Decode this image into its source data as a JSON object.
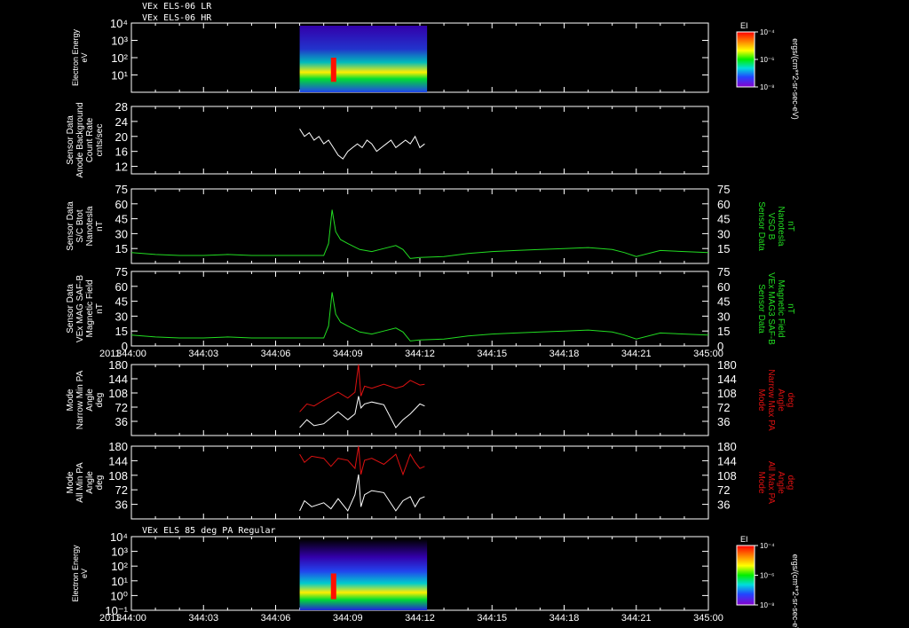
{
  "header": {
    "line1": "VEx ELS-06 LR",
    "line2": "VEx ELS-06 HR",
    "bottom_title": "VEx ELS 85 deg PA Regular"
  },
  "colors": {
    "white": "#ffffff",
    "green": "#22dd22",
    "red": "#dd1111",
    "background": "#000000"
  },
  "colorbar": {
    "label": "EI",
    "units": "ergs/(cm**2-sr-sec-eV)",
    "tick_labels": [
      "10⁻⁴",
      "10⁻⁶",
      "10⁻⁸"
    ]
  },
  "time_axis": {
    "year": "2011",
    "tick_labels": [
      "344:00",
      "344:03",
      "344:06",
      "344:09",
      "344:12",
      "344:15",
      "344:18",
      "344:21",
      "345:00"
    ],
    "range_min": [
      0,
      24
    ]
  },
  "chart_data": [
    {
      "type": "heatmap",
      "name": "panel1",
      "ylabel_lines": [
        "Electron Energy",
        "eV"
      ],
      "y_scale": "log",
      "yticks": [
        "10⁴",
        "10³",
        "10²",
        "10¹"
      ],
      "ylim": [
        1,
        10000
      ],
      "data_span_min": [
        7,
        12.3
      ],
      "grid": false
    },
    {
      "type": "line",
      "name": "panel2",
      "ylabel_lines": [
        "Sensor Data",
        "Anode Background",
        "Count Rate",
        "cnts/sec"
      ],
      "yticks": [
        "28",
        "24",
        "20",
        "16",
        "12"
      ],
      "ylim": [
        10,
        28
      ],
      "series": [
        {
          "color": "white",
          "x": [
            7,
            7.2,
            7.4,
            7.6,
            7.8,
            8.0,
            8.2,
            8.4,
            8.6,
            8.8,
            9.0,
            9.2,
            9.4,
            9.6,
            9.8,
            10.0,
            10.2,
            10.4,
            10.6,
            10.8,
            11.0,
            11.2,
            11.4,
            11.6,
            11.8,
            12.0,
            12.2
          ],
          "y": [
            22,
            20,
            21,
            19,
            20,
            18,
            19,
            17,
            15,
            14,
            16,
            17,
            18,
            17,
            19,
            18,
            16,
            17,
            18,
            19,
            17,
            18,
            19,
            18,
            20,
            17,
            18
          ]
        }
      ]
    },
    {
      "type": "line",
      "name": "panel3",
      "ylabel_lines": [
        "Sensor Data",
        "S/C Btot",
        "Nanotesla",
        "nT"
      ],
      "ylabel_right_lines": [
        "Sensor Data",
        "VSO B",
        "Nanotesla",
        "nT"
      ],
      "yticks": [
        "75",
        "60",
        "45",
        "30",
        "15"
      ],
      "ylim": [
        0,
        75
      ],
      "series": [
        {
          "color": "green",
          "x": [
            0,
            1,
            2,
            3,
            4,
            5,
            6,
            7,
            7.6,
            8.0,
            8.2,
            8.35,
            8.5,
            8.7,
            9.0,
            9.5,
            10.0,
            10.5,
            11.0,
            11.3,
            11.6,
            12,
            13,
            14,
            15,
            16,
            17,
            18,
            19,
            20,
            20.5,
            21,
            22,
            23,
            24
          ],
          "y": [
            11,
            9,
            8,
            8,
            9,
            8,
            8,
            8,
            8,
            8,
            20,
            54,
            32,
            24,
            20,
            14,
            12,
            15,
            18,
            14,
            5,
            6,
            7,
            10,
            12,
            13,
            14,
            15,
            16,
            14,
            11,
            7,
            13,
            12,
            11
          ]
        }
      ]
    },
    {
      "type": "line",
      "name": "panel4",
      "ylabel_lines": [
        "Sensor Data",
        "VEx MAG SAF-B",
        "Magnetic Field",
        "nT"
      ],
      "ylabel_right_lines": [
        "Sensor Data",
        "VEx MAG3 SAF-B",
        "Magnetic Field",
        "nT"
      ],
      "yticks": [
        "75",
        "60",
        "45",
        "30",
        "15",
        "0"
      ],
      "ylim": [
        0,
        75
      ],
      "series": [
        {
          "color": "green",
          "x": [
            0,
            1,
            2,
            3,
            4,
            5,
            6,
            7,
            7.6,
            8.0,
            8.2,
            8.35,
            8.5,
            8.7,
            9.0,
            9.5,
            10.0,
            10.5,
            11.0,
            11.3,
            11.6,
            12,
            13,
            14,
            15,
            16,
            17,
            18,
            19,
            20,
            20.5,
            21,
            22,
            23,
            24
          ],
          "y": [
            11,
            9,
            8,
            8,
            9,
            8,
            8,
            8,
            8,
            8,
            20,
            54,
            32,
            24,
            20,
            14,
            12,
            15,
            18,
            14,
            5,
            6,
            7,
            10,
            12,
            13,
            14,
            15,
            16,
            14,
            11,
            7,
            13,
            12,
            11
          ]
        }
      ]
    },
    {
      "type": "line",
      "name": "panel5",
      "ylabel_lines": [
        "Mode",
        "Narrow Min PA",
        "Angle",
        "deg"
      ],
      "ylabel_right_lines": [
        "Mode",
        "Narrow Max PA",
        "Angle",
        "deg"
      ],
      "yticks": [
        "180",
        "144",
        "108",
        "72",
        "36"
      ],
      "ylim": [
        0,
        180
      ],
      "series": [
        {
          "color": "red",
          "x": [
            7,
            7.3,
            7.6,
            8.0,
            8.3,
            8.6,
            9.0,
            9.3,
            9.45,
            9.55,
            9.7,
            10.0,
            10.5,
            11.0,
            11.3,
            11.6,
            12.0,
            12.2
          ],
          "y": [
            60,
            80,
            75,
            90,
            100,
            110,
            95,
            110,
            180,
            100,
            125,
            120,
            130,
            120,
            125,
            140,
            128,
            130
          ]
        },
        {
          "color": "white",
          "x": [
            7,
            7.3,
            7.6,
            8.0,
            8.3,
            8.6,
            9.0,
            9.3,
            9.45,
            9.55,
            9.7,
            10.0,
            10.5,
            11.0,
            11.3,
            11.6,
            12.0,
            12.2
          ],
          "y": [
            20,
            40,
            25,
            30,
            45,
            60,
            40,
            55,
            100,
            70,
            80,
            85,
            78,
            20,
            40,
            55,
            80,
            75
          ]
        }
      ]
    },
    {
      "type": "line",
      "name": "panel6",
      "ylabel_lines": [
        "Mode",
        "All Min PA",
        "Angle",
        "deg"
      ],
      "ylabel_right_lines": [
        "Mode",
        "All Max PA",
        "Angle",
        "deg"
      ],
      "yticks": [
        "180",
        "144",
        "108",
        "72",
        "36"
      ],
      "ylim": [
        0,
        180
      ],
      "series": [
        {
          "color": "red",
          "x": [
            7,
            7.2,
            7.5,
            8.0,
            8.3,
            8.6,
            9.0,
            9.3,
            9.45,
            9.55,
            9.7,
            10.0,
            10.5,
            11.0,
            11.3,
            11.6,
            11.8,
            12.0,
            12.2
          ],
          "y": [
            160,
            140,
            155,
            150,
            130,
            150,
            145,
            125,
            180,
            110,
            145,
            150,
            135,
            160,
            110,
            160,
            140,
            125,
            130
          ]
        },
        {
          "color": "white",
          "x": [
            7,
            7.2,
            7.5,
            8.0,
            8.3,
            8.6,
            9.0,
            9.3,
            9.45,
            9.55,
            9.7,
            10.0,
            10.5,
            11.0,
            11.3,
            11.6,
            11.8,
            12.0,
            12.2
          ],
          "y": [
            20,
            45,
            30,
            40,
            25,
            50,
            20,
            60,
            110,
            30,
            60,
            70,
            65,
            20,
            45,
            55,
            30,
            50,
            55
          ]
        }
      ]
    },
    {
      "type": "heatmap",
      "name": "panel7",
      "ylabel_lines": [
        "Electron Energy",
        "eV"
      ],
      "y_scale": "log",
      "yticks": [
        "10⁴",
        "10³",
        "10²",
        "10¹",
        "10⁰",
        "10⁻¹"
      ],
      "ylim": [
        0.1,
        10000
      ],
      "data_span_min": [
        7,
        12.3
      ],
      "grid": false
    }
  ]
}
